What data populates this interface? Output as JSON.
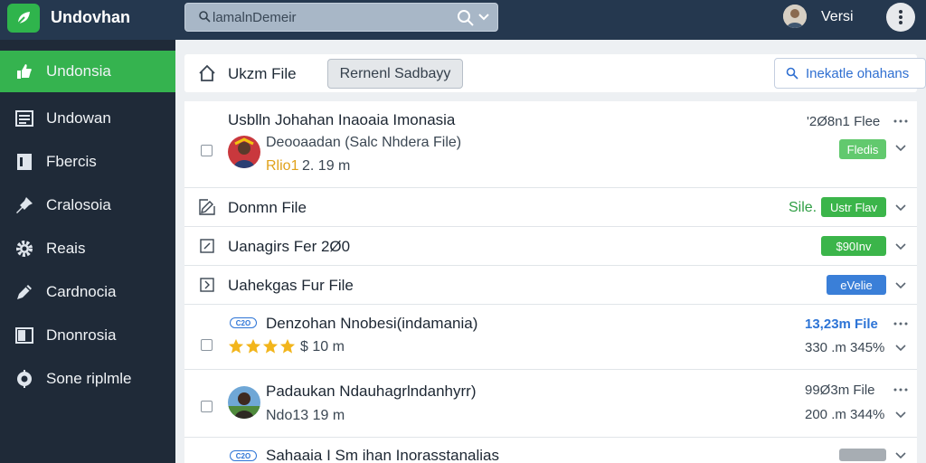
{
  "app": {
    "title": "Undovhan",
    "user_name": "Versi"
  },
  "search": {
    "placeholder": "lamalnDemeir"
  },
  "sidebar": {
    "items": [
      {
        "label": "Undonsia",
        "icon": "thumb-icon"
      },
      {
        "label": "Undowan",
        "icon": "list-icon"
      },
      {
        "label": "Fbercis",
        "icon": "document-icon"
      },
      {
        "label": "Cralosoia",
        "icon": "pin-icon"
      },
      {
        "label": "Reais",
        "icon": "gear-icon"
      },
      {
        "label": "Cardnocia",
        "icon": "pencil-icon"
      },
      {
        "label": "Dnonrosia",
        "icon": "panel-icon"
      },
      {
        "label": "Sone riplmle",
        "icon": "settings-cog-icon"
      }
    ]
  },
  "toolbar": {
    "title": "Ukzm File",
    "primary_button": "Rernenl Sadbayy",
    "outline_button": "Inekatle ohahans"
  },
  "rows": [
    {
      "title": "Usblln Johahan Inaoaia Imonasia",
      "subtitle": "Deooaadan (Salc Nhdera File)",
      "meta_a": "Rlio1",
      "meta_b": "2. 19 m",
      "size": "'2Ø8n1 Flee",
      "badge": "Fledis"
    },
    {
      "title": "Donmn File",
      "status": "Sile.",
      "badge": "Ustr Flav"
    },
    {
      "title": "Uanagirs Fer 2Ø0",
      "badge": "$90Inv"
    },
    {
      "title": "Uahekgas Fur File",
      "badge": "eVelie"
    },
    {
      "pill": "C2O",
      "title": "Denzohan Nnobesi(indamania)",
      "meta_b": "$ 10 m",
      "size": "13,23m File",
      "size2": "330 .m 345%"
    },
    {
      "title": "Padaukan Ndauhagrlndanhyrr)",
      "meta_b": "Ndo13 19 m",
      "size": "99Ø3m File",
      "size2": "200 .m 344%"
    },
    {
      "pill": "C2O",
      "title": "Sahaaia I Sm ihan Inorasstanalias"
    }
  ],
  "colors": {
    "topbar": "#25384f",
    "sidebar": "#1f2a38",
    "accent_green": "#35b34f",
    "link_blue": "#2d74d6"
  }
}
